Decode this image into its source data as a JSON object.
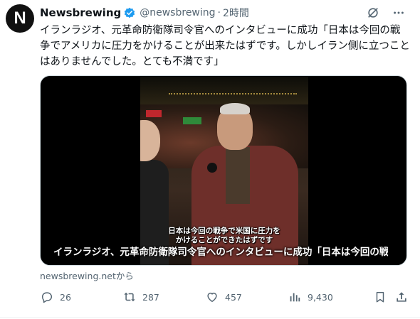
{
  "post": {
    "avatar_letter": "N",
    "display_name": "Newsbrewing",
    "handle": "@newsbrewing",
    "separator": "·",
    "time": "2時間",
    "text": "イランラジオ、元革命防衛隊司令官へのインタビューに成功「日本は今回の戦争でアメリカに圧力をかけることが出来たはずです。しかしイラン側に立つことはありませんでした。とても不満です」",
    "verified_icon": "verified-badge-icon",
    "accent_color": "#1d9bf0"
  },
  "header_icons": [
    "grok-icon",
    "more-icon"
  ],
  "media": {
    "subtitle_line1": "日本は今回の戦争で米国に圧力を",
    "subtitle_line2": "かけることができたはずです",
    "caption": "イランラジオ、元革命防衛隊司令官へのインタビューに成功「日本は今回の戦..."
  },
  "source": "newsbrewing.netから",
  "actions": {
    "reply": {
      "icon": "reply-icon",
      "count": "26"
    },
    "repost": {
      "icon": "repost-icon",
      "count": "287"
    },
    "like": {
      "icon": "like-icon",
      "count": "457"
    },
    "views": {
      "icon": "views-icon",
      "count": "9,430"
    },
    "bookmark": {
      "icon": "bookmark-icon"
    },
    "share": {
      "icon": "share-icon"
    }
  }
}
